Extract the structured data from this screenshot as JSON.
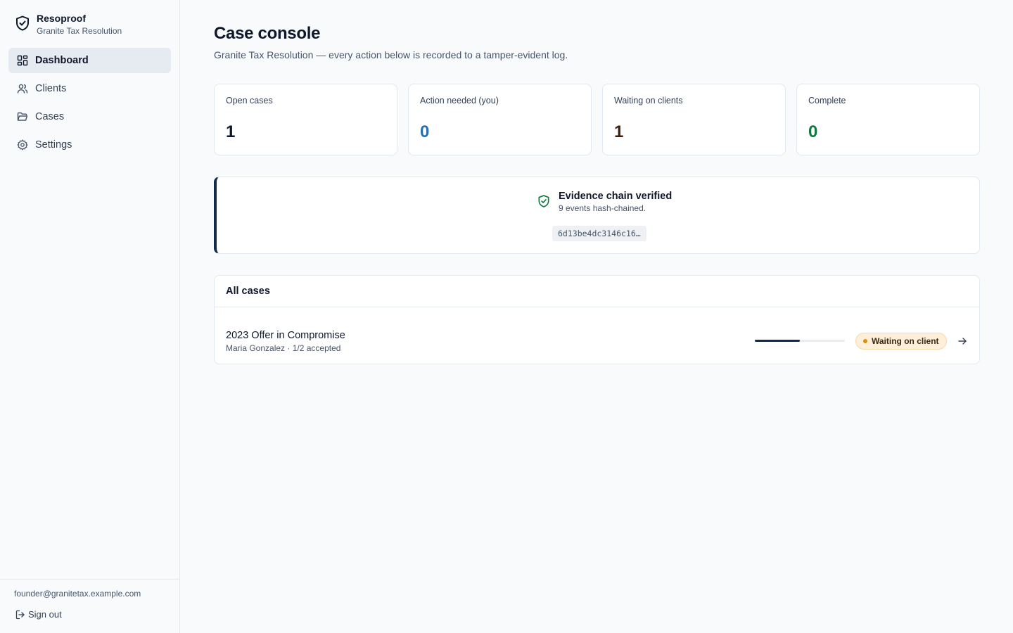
{
  "brand": {
    "name": "Resoproof",
    "org": "Granite Tax Resolution"
  },
  "nav": {
    "items": [
      {
        "label": "Dashboard",
        "icon": "dashboard-icon",
        "active": true
      },
      {
        "label": "Clients",
        "icon": "users-icon",
        "active": false
      },
      {
        "label": "Cases",
        "icon": "folder-icon",
        "active": false
      },
      {
        "label": "Settings",
        "icon": "gear-icon",
        "active": false
      }
    ]
  },
  "user": {
    "email": "founder@granitetax.example.com",
    "signout_label": "Sign out"
  },
  "page": {
    "title": "Case console",
    "subtitle": "Granite Tax Resolution — every action below is recorded to a tamper-evident log."
  },
  "stats": [
    {
      "label": "Open cases",
      "value": "1",
      "color": "#0f172a"
    },
    {
      "label": "Action needed (you)",
      "value": "0",
      "color": "#2a6db0"
    },
    {
      "label": "Waiting on clients",
      "value": "1",
      "color": "#3b1f0e"
    },
    {
      "label": "Complete",
      "value": "0",
      "color": "#137a3f"
    }
  ],
  "evidence": {
    "title": "Evidence chain verified",
    "subtitle": "9 events hash-chained.",
    "hash": "6d13be4dc3146c16…",
    "accent": "#0f2a4a",
    "icon_color": "#137a3f"
  },
  "cases": {
    "header": "All cases",
    "rows": [
      {
        "title": "2023 Offer in Compromise",
        "meta": "Maria Gonzalez · 1/2 accepted",
        "progress": 0.5,
        "status": "Waiting on client",
        "status_color": "#e58b0c"
      }
    ]
  }
}
